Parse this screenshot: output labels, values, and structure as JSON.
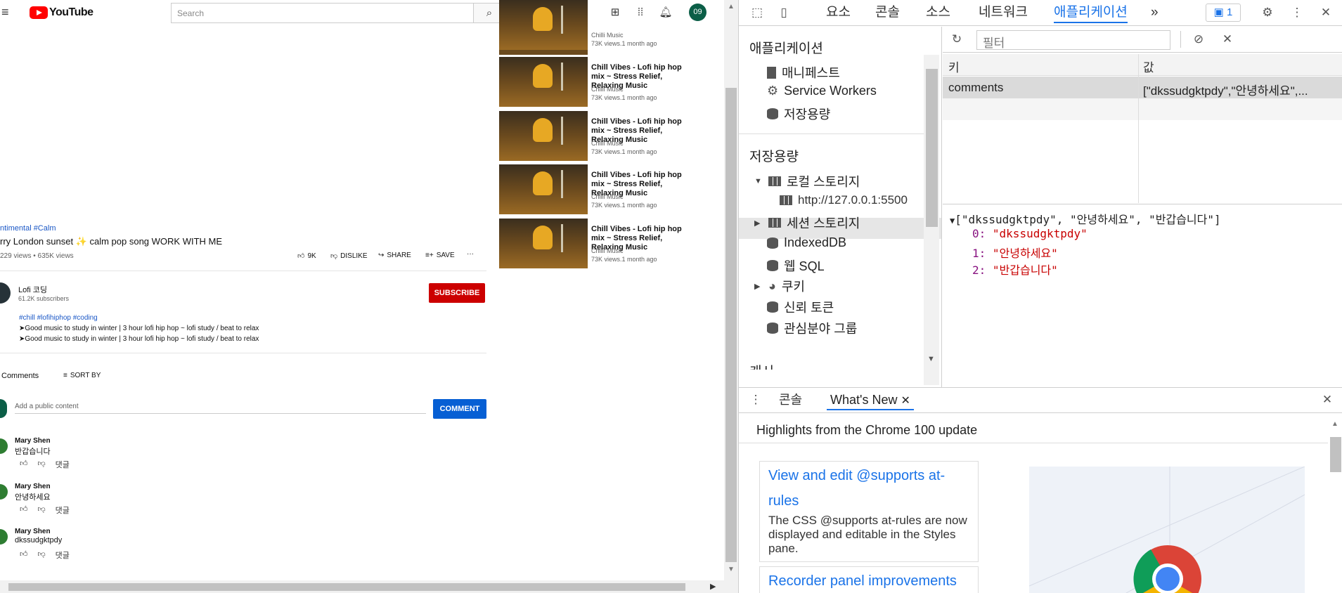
{
  "youtube": {
    "logo_text": "YouTube",
    "search_placeholder": "Search",
    "avatar_text": "09",
    "video": {
      "hashtags": "ntimental #Calm",
      "title": "rry London sunset ✨ calm pop song WORK WITH ME",
      "meta": "229 views • 635K views",
      "likes": "9K",
      "dislike_label": "DISLIKE",
      "share_label": "SHARE",
      "save_label": "SAVE"
    },
    "channel": {
      "name": "Lofi 코딩",
      "subscribers": "61.2K subscribers",
      "subscribe_label": "SUBSCRIBE",
      "tags": "#chill #lofihiphop #coding",
      "desc1": "➤Good music to study in winter | 3 hour lofi hip hop ~ lofi study / beat to relax",
      "desc2": "➤Good music to study in winter | 3 hour lofi hip hop ~ lofi study / beat to relax"
    },
    "comments_header": "Comments",
    "sort_label": "SORT BY",
    "comment_placeholder": "Add a public content",
    "comment_button": "COMMENT",
    "comments": [
      {
        "name": "Mary Shen",
        "text": "반갑습니다",
        "reply": "댓글"
      },
      {
        "name": "Mary Shen",
        "text": "안녕하세요",
        "reply": "댓글"
      },
      {
        "name": "Mary Shen",
        "text": "dkssudgktpdy",
        "reply": "댓글"
      }
    ],
    "related": [
      {
        "title": "",
        "channel": "Chilli Music",
        "meta": "73K views.1 month ago"
      },
      {
        "title": "Chill Vibes - Lofi hip hop mix ~ Stress Relief, Relaxing Music",
        "channel": "Chilli Music",
        "meta": "73K views.1 month ago"
      },
      {
        "title": "Chill Vibes - Lofi hip hop mix ~ Stress Relief, Relaxing Music",
        "channel": "Chilli Music",
        "meta": "73K views.1 month ago"
      },
      {
        "title": "Chill Vibes - Lofi hip hop mix ~ Stress Relief, Relaxing Music",
        "channel": "Chilli Music",
        "meta": "73K views.1 month ago"
      },
      {
        "title": "Chill Vibes - Lofi hip hop mix ~ Stress Relief, Relaxing Music",
        "channel": "Chilli Music",
        "meta": "73K views.1 month ago"
      }
    ]
  },
  "devtools": {
    "tabs": [
      "요소",
      "콘솔",
      "소스",
      "네트워크",
      "애플리케이션"
    ],
    "more_tabs": "»",
    "issues_count": "1",
    "sidebar": {
      "app_header": "애플리케이션",
      "manifest": "매니페스트",
      "service_workers": "Service Workers",
      "storage": "저장용량",
      "storage_header": "저장용량",
      "local_storage": "로컬 스토리지",
      "local_origin": "http://127.0.0.1:5500",
      "session_storage": "세션 스토리지",
      "indexeddb": "IndexedDB",
      "websql": "웹 SQL",
      "cookies": "쿠키",
      "trust_tokens": "신뢰 토큰",
      "interest_groups": "관심분야 그룹",
      "cache_header": "캐시"
    },
    "filter_placeholder": "필터",
    "table": {
      "key_header": "키",
      "value_header": "값",
      "rows": [
        {
          "key": "comments",
          "value": "[\"dkssudgktpdy\",\"안녕하세요\",..."
        }
      ]
    },
    "preview": {
      "summary": "[\"dkssudgktpdy\", \"안녕하세요\", \"반갑습니다\"]",
      "items": [
        {
          "index": "0:",
          "value": "\"dkssudgktpdy\""
        },
        {
          "index": "1:",
          "value": "\"안녕하세요\""
        },
        {
          "index": "2:",
          "value": "\"반갑습니다\""
        }
      ]
    },
    "drawer": {
      "tab_console": "콘솔",
      "tab_whats_new": "What's New",
      "highlight": "Highlights from the Chrome 100 update",
      "card1_title": "View and edit @supports at-rules",
      "card1_desc": "The CSS @supports at-rules are now displayed and editable in the Styles pane.",
      "card2_title": "Recorder panel improvements"
    }
  }
}
